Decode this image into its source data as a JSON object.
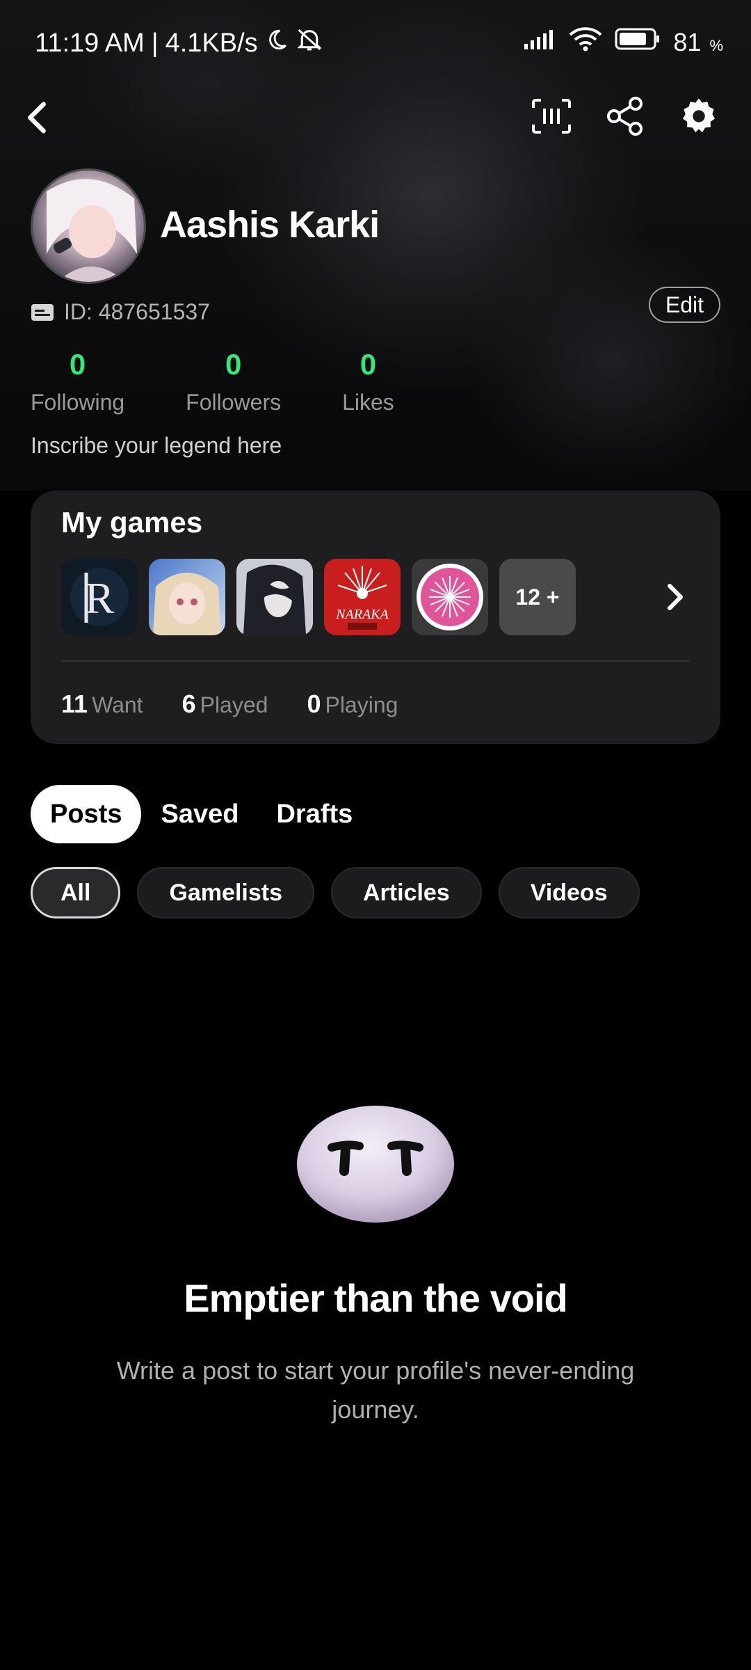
{
  "status_bar": {
    "time": "11:19 AM",
    "separator": "|",
    "net_speed": "4.1KB/s",
    "battery_level": "81",
    "battery_unit": "%"
  },
  "nav": {
    "icons": [
      "back-icon",
      "scan-icon",
      "share-icon",
      "settings-icon"
    ]
  },
  "profile": {
    "name": "Aashis Karki",
    "id_text": "ID: 487651537",
    "edit_label": "Edit",
    "stats": [
      {
        "value": "0",
        "label": "Following"
      },
      {
        "value": "0",
        "label": "Followers"
      },
      {
        "value": "0",
        "label": "Likes"
      }
    ],
    "bio": "Inscribe your legend here"
  },
  "games": {
    "title": "My games",
    "more_label": "12 +",
    "items": [
      {
        "name": "runescape-icon",
        "color": "#0f1a24"
      },
      {
        "name": "anime-girl-game-icon",
        "color": "#6c8fc7"
      },
      {
        "name": "dark-anime-game-icon",
        "color": "#2a2a33"
      },
      {
        "name": "naraka-icon",
        "color": "#c81e1e"
      },
      {
        "name": "pink-burst-icon",
        "color": "#e0559a"
      }
    ],
    "counts": [
      {
        "value": "11",
        "label": "Want"
      },
      {
        "value": "6",
        "label": "Played"
      },
      {
        "value": "0",
        "label": "Playing"
      }
    ]
  },
  "tabs": [
    {
      "label": "Posts",
      "active": true
    },
    {
      "label": "Saved",
      "active": false
    },
    {
      "label": "Drafts",
      "active": false
    }
  ],
  "filters": [
    {
      "label": "All",
      "active": true
    },
    {
      "label": "Gamelists",
      "active": false
    },
    {
      "label": "Articles",
      "active": false
    },
    {
      "label": "Videos",
      "active": false
    }
  ],
  "empty": {
    "title": "Emptier than the void",
    "description": "Write a post to start your profile's never-ending journey."
  },
  "colors": {
    "accent_green": "#37e67a",
    "background": "#000000",
    "card": "#1e1e20"
  }
}
